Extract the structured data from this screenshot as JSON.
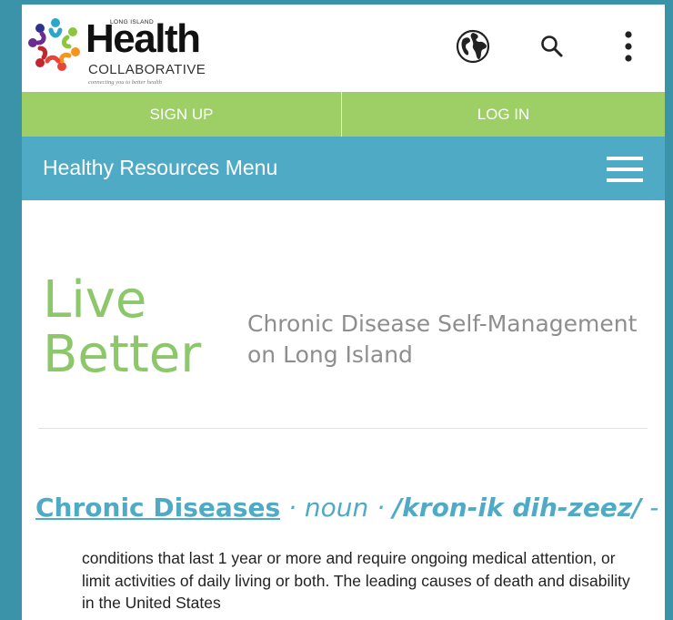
{
  "brand": {
    "top": "LONG ISLAND",
    "name": "Health",
    "sub": "COLLABORATIVE",
    "tagline": "connecting you to better health"
  },
  "header_icons": [
    "globe-icon",
    "search-icon",
    "more-vertical-icon"
  ],
  "auth": {
    "signup": "SIGN UP",
    "login": "LOG IN"
  },
  "resources": {
    "title": "Healthy Resources Menu",
    "menu_icon": "hamburger-icon"
  },
  "hero": {
    "line1": "Live",
    "line2": "Better",
    "subtitle": "Chronic Disease Self-Management on Long Island"
  },
  "definition": {
    "term": "Chronic Diseases",
    "pos": " · noun · ",
    "pronunciation": "/kron-ik  dih-zeez/",
    "dash": " -",
    "body": "conditions that last 1 year or more and require ongoing medical attention, or limit activities of daily living or both. The leading causes of death and disability in the United States"
  },
  "colors": {
    "frame": "#3a93a8",
    "green": "#9dcf66",
    "blue": "#4faac6",
    "hero_green": "#8cc86a",
    "subtitle_gray": "#8e8e8e"
  }
}
